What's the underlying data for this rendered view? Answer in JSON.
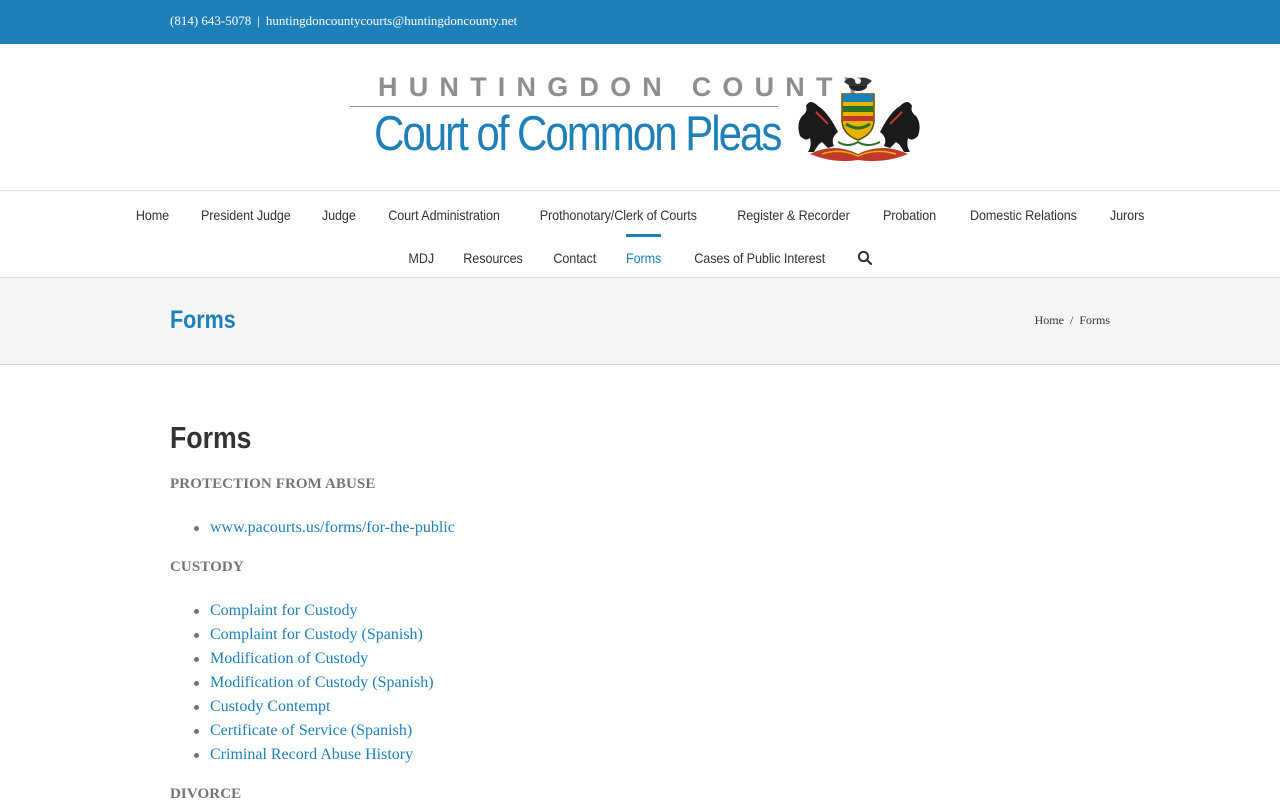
{
  "topbar": {
    "phone": "(814) 643-5078",
    "separator": "|",
    "email": "huntingdoncountycourts@huntingdoncounty.net"
  },
  "logo": {
    "county": "HUNTINGDON COUNTY",
    "court": "Court of Common Pleas",
    "seal_icon": "pennsylvania-coat-of-arms"
  },
  "nav": {
    "row1": [
      {
        "label": "Home"
      },
      {
        "label": "President Judge"
      },
      {
        "label": "Judge"
      },
      {
        "label": "Court Administration"
      },
      {
        "label": "Prothonotary/Clerk of Courts"
      },
      {
        "label": "Register & Recorder"
      },
      {
        "label": "Probation"
      },
      {
        "label": "Domestic Relations"
      },
      {
        "label": "Jurors"
      }
    ],
    "row2": [
      {
        "label": "MDJ"
      },
      {
        "label": "Resources"
      },
      {
        "label": "Contact"
      },
      {
        "label": "Forms",
        "active": true
      },
      {
        "label": "Cases of Public Interest"
      }
    ],
    "search_icon": "search-icon"
  },
  "page_title": "Forms",
  "breadcrumb": {
    "home": "Home",
    "separator": "/",
    "current": "Forms"
  },
  "content": {
    "heading": "Forms",
    "sections": [
      {
        "title": "PROTECTION FROM ABUSE",
        "links": [
          "www.pacourts.us/forms/for-the-public"
        ]
      },
      {
        "title": "CUSTODY",
        "links": [
          "Complaint for Custody",
          "Complaint for Custody (Spanish)",
          "Modification of Custody",
          "Modification of Custody (Spanish)",
          "Custody Contempt",
          "Certificate of Service (Spanish)",
          "Criminal Record Abuse History"
        ]
      },
      {
        "title": "DIVORCE",
        "links": []
      }
    ]
  },
  "colors": {
    "accent": "#1e80b8",
    "text": "#747474",
    "nav_text": "#333333"
  }
}
